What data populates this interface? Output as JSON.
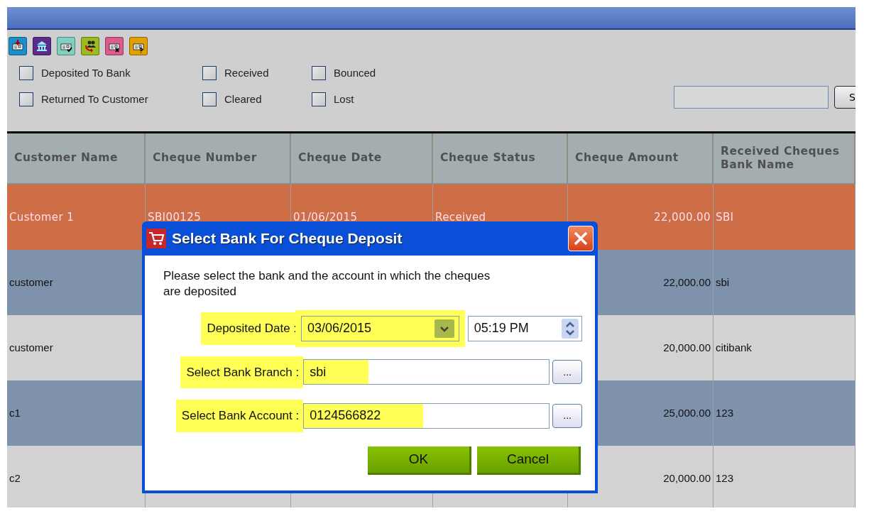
{
  "toolbar": [
    {
      "kind": "card-arrow",
      "color": "#1a8fc9"
    },
    {
      "kind": "bank",
      "color": "#5b2d8a"
    },
    {
      "kind": "card-check",
      "color": "#7fd0c0"
    },
    {
      "kind": "people",
      "color": "#9bbb1e"
    },
    {
      "kind": "card-x",
      "color": "#dd5a8e"
    },
    {
      "kind": "card-question",
      "color": "#e0a000"
    }
  ],
  "filters": [
    {
      "label": "Deposited To Bank",
      "checked": false
    },
    {
      "label": "Received",
      "checked": false
    },
    {
      "label": "Bounced",
      "checked": false
    },
    {
      "label": "Returned To Customer",
      "checked": false
    },
    {
      "label": "Cleared",
      "checked": false
    },
    {
      "label": "Lost",
      "checked": false
    }
  ],
  "search_button": {
    "label": "S"
  },
  "table": {
    "columns": [
      "Customer Name",
      "Cheque Number",
      "Cheque Date",
      "Cheque Status",
      "Cheque Amount",
      "Received Cheques Bank Name"
    ],
    "rows": [
      {
        "selected": true,
        "cells": [
          "Customer 1",
          "SBI00125",
          "01/06/2015",
          "Received",
          "22,000.00",
          "SBI"
        ]
      },
      {
        "selected": false,
        "cells": [
          "customer",
          null,
          null,
          null,
          "22,000.00",
          "sbi"
        ]
      },
      {
        "selected": false,
        "cells": [
          "customer",
          null,
          null,
          null,
          "20,000.00",
          "citibank"
        ]
      },
      {
        "selected": false,
        "cells": [
          "c1",
          null,
          null,
          null,
          "25,000.00",
          "123"
        ]
      },
      {
        "selected": false,
        "cells": [
          "c2",
          null,
          null,
          null,
          "20,000.00",
          "123"
        ]
      }
    ]
  },
  "dialog": {
    "title": "Select Bank For Cheque Deposit",
    "message": "Please select the bank and the account in which the cheques are deposited",
    "fields": [
      {
        "kind": "date",
        "label": "Deposited Date :",
        "value": "03/06/2015",
        "time": "05:19 PM",
        "highlighted": true
      },
      {
        "kind": "lookup",
        "label": "Select Bank Branch :",
        "value": "sbi",
        "button": "...",
        "highlighted": true
      },
      {
        "kind": "lookup",
        "label": "Select Bank Account :",
        "value": "0124566822",
        "button": "...",
        "highlighted": true
      }
    ],
    "buttons": [
      "OK",
      "Cancel"
    ]
  }
}
